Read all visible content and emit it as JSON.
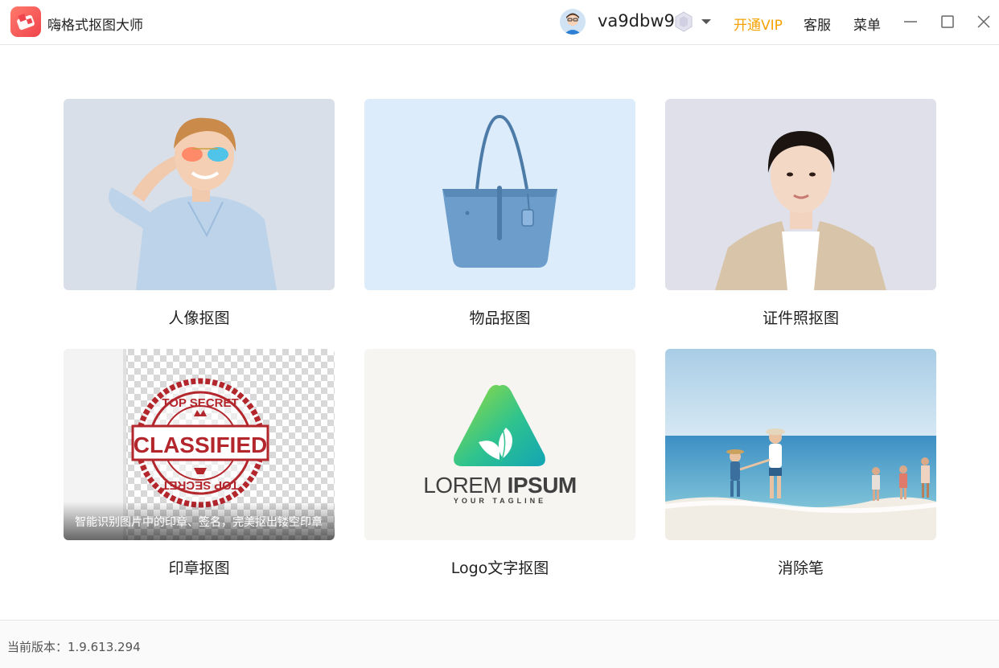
{
  "app": {
    "name": "嗨格式抠图大师",
    "username": "va9dbw9",
    "vip_label": "开通VIP",
    "service_label": "客服",
    "menu_label": "菜单",
    "accent_color": "#f5a100"
  },
  "cards": [
    {
      "label": "人像抠图",
      "background": "#d9dfe9"
    },
    {
      "label": "物品抠图",
      "background": "#dcecfb"
    },
    {
      "label": "证件照抠图",
      "background": "#e0e0ea"
    },
    {
      "label": "印章抠图",
      "overlay": "智能识别图片中的印章、签名，完美抠出镂空印章",
      "stamp": {
        "top": "TOP SECRET",
        "main": "CLASSIFIED",
        "bottom": "TOP SECRET"
      }
    },
    {
      "label": "Logo文字抠图",
      "logo_main_light": "LOREM",
      "logo_main_bold": "IPSUM",
      "logo_tagline": "YOUR TAGLINE"
    },
    {
      "label": "消除笔"
    }
  ],
  "footer": {
    "version_text": "当前版本：1.9.613.294"
  }
}
